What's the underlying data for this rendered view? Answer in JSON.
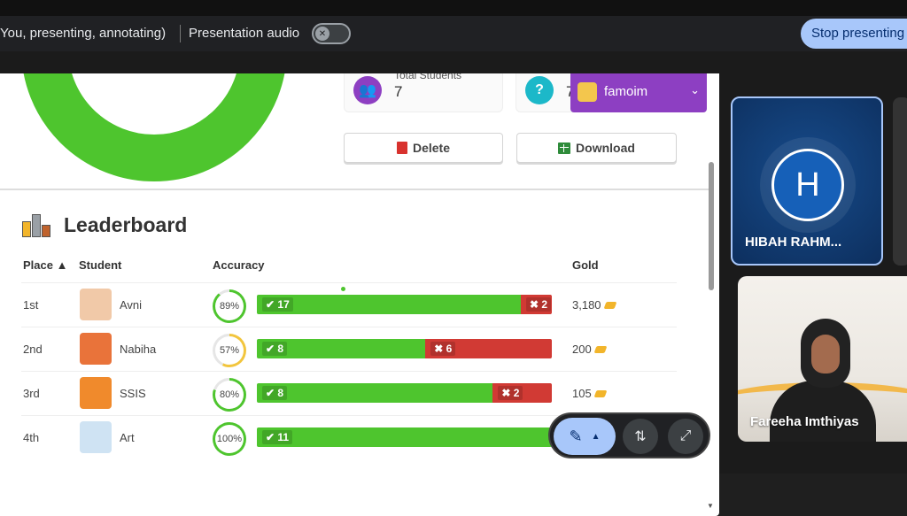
{
  "presentation_bar": {
    "status_text": "You, presenting, annotating)",
    "audio_label": "Presentation audio",
    "stop_button": "Stop presenting"
  },
  "stats": {
    "total_students_label": "Total Students",
    "total_students_value": "7",
    "second_card_label": "?",
    "second_card_value": "7"
  },
  "account": {
    "name": "famoim"
  },
  "actions": {
    "delete_label": "Delete",
    "download_label": "Download"
  },
  "leaderboard": {
    "title": "Leaderboard",
    "columns": {
      "place": "Place ▲",
      "student": "Student",
      "accuracy": "Accuracy",
      "gold": "Gold"
    },
    "rows": [
      {
        "place": "1st",
        "student": "Avni",
        "accuracy_text": "89%",
        "accuracy": 89,
        "correct": 17,
        "correct_label": "✔ 17",
        "wrong": 2,
        "wrong_label": "✖ 2",
        "gold": "3,180",
        "avatar_color": "#f1c9a8"
      },
      {
        "place": "2nd",
        "student": "Nabiha",
        "accuracy_text": "57%",
        "accuracy": 57,
        "correct": 8,
        "correct_label": "✔ 8",
        "wrong": 6,
        "wrong_label": "✖ 6",
        "gold": "200",
        "avatar_color": "#e9733a"
      },
      {
        "place": "3rd",
        "student": "SSIS",
        "accuracy_text": "80%",
        "accuracy": 80,
        "correct": 8,
        "correct_label": "✔ 8",
        "wrong": 2,
        "wrong_label": "✖ 2",
        "gold": "105",
        "avatar_color": "#f08a2c"
      },
      {
        "place": "4th",
        "student": "Art",
        "accuracy_text": "100%",
        "accuracy": 100,
        "correct": 11,
        "correct_label": "✔ 11",
        "wrong": 0,
        "wrong_label": "",
        "gold": "",
        "avatar_color": "#cfe3f3"
      }
    ]
  },
  "participants": [
    {
      "name": "HIBAH RAHM...",
      "initial": "H"
    },
    {
      "name": "Fareeha Imthiyas"
    }
  ],
  "colors": {
    "correct": "#4ec52e",
    "wrong": "#d13a34",
    "low_accuracy": "#f2c53d",
    "accent": "#a8c7fa"
  }
}
